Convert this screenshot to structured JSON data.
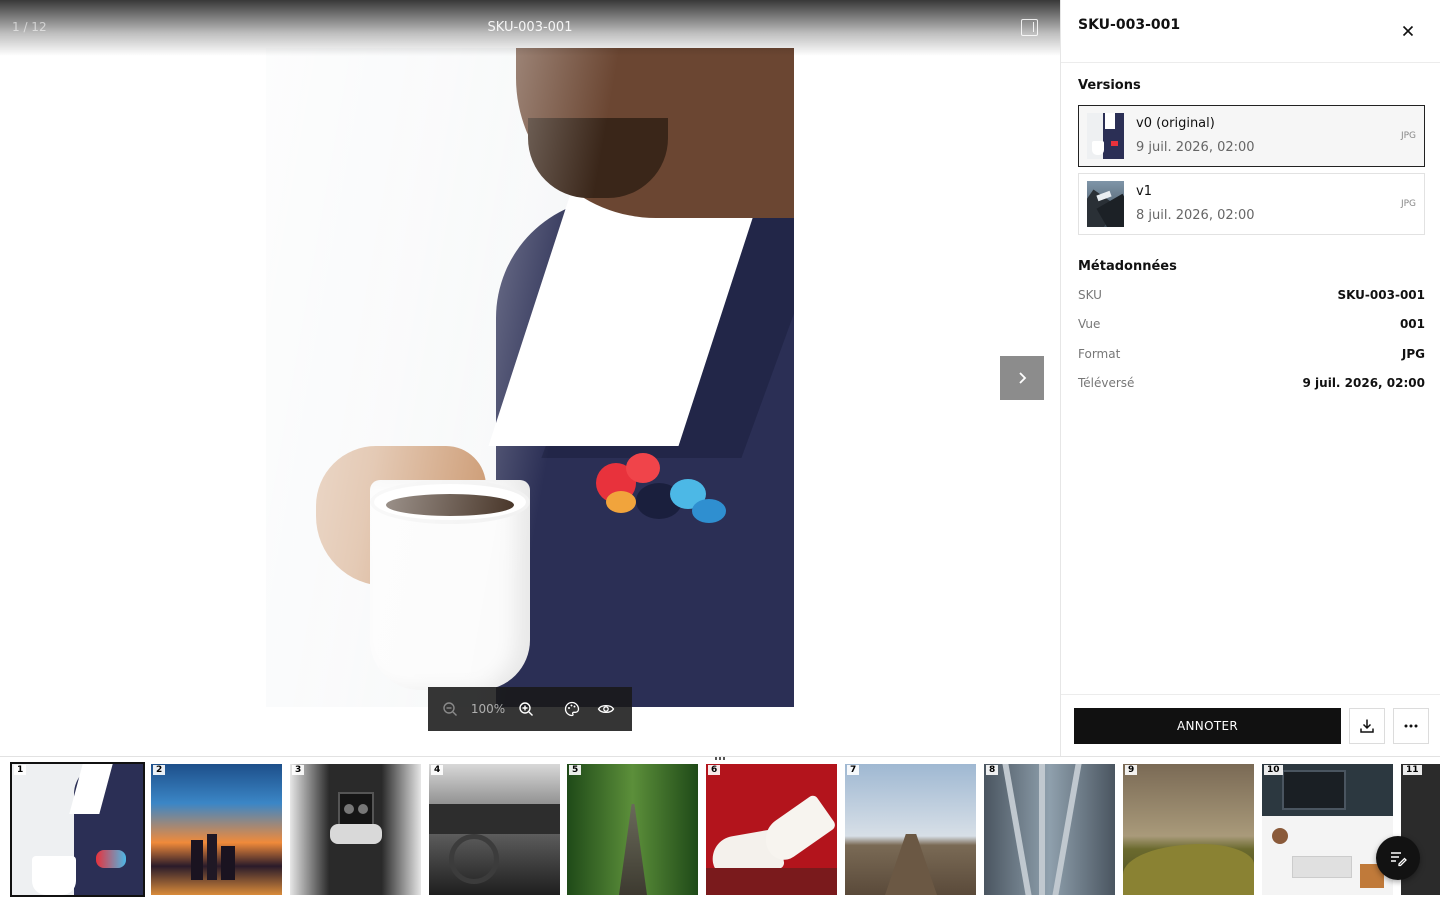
{
  "viewer": {
    "counter": "1 / 12",
    "title": "SKU-003-001",
    "zoom": "100%"
  },
  "panel": {
    "title": "SKU-003-001",
    "versions_heading": "Versions",
    "versions": [
      {
        "name": "v0 (original)",
        "date": "9 juil. 2026, 02:00",
        "format": "JPG",
        "selected": true
      },
      {
        "name": "v1",
        "date": "8 juil. 2026, 02:00",
        "format": "JPG",
        "selected": false
      }
    ],
    "metadata_heading": "Métadonnées",
    "metadata": [
      {
        "key": "SKU",
        "value": "SKU-003-001"
      },
      {
        "key": "Vue",
        "value": "001"
      },
      {
        "key": "Format",
        "value": "JPG"
      },
      {
        "key": "Téléversé",
        "value": "9 juil. 2026, 02:00"
      }
    ],
    "annotate_label": "ANNOTER"
  },
  "filmstrip": {
    "items": [
      {
        "num": "1",
        "subject": "coffee-suit"
      },
      {
        "num": "2",
        "subject": "city-sunset"
      },
      {
        "num": "3",
        "subject": "vintage-camera"
      },
      {
        "num": "4",
        "subject": "car-interior"
      },
      {
        "num": "5",
        "subject": "forest-railway"
      },
      {
        "num": "6",
        "subject": "white-heels"
      },
      {
        "num": "7",
        "subject": "pier"
      },
      {
        "num": "8",
        "subject": "railway-tracks"
      },
      {
        "num": "9",
        "subject": "hill"
      },
      {
        "num": "10",
        "subject": "desk-workspace"
      },
      {
        "num": "11",
        "subject": "partial"
      }
    ],
    "active_index": 0
  },
  "colors": {
    "primary": "#111111",
    "panel_border": "#e6e6e6",
    "zoombar_bg": "#191919"
  }
}
